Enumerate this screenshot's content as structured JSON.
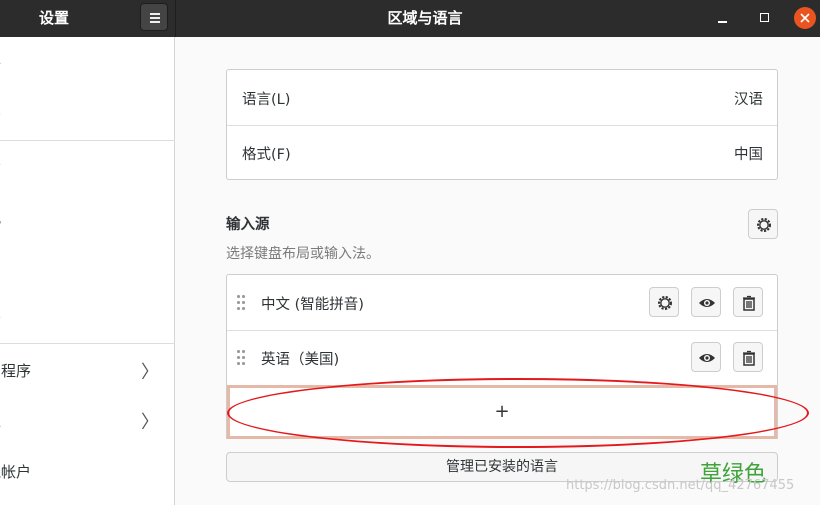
{
  "header": {
    "app_title": "设置",
    "page_title": "区域与语言"
  },
  "sidebar": {
    "items": [
      {
        "label": "络"
      },
      {
        "label": "牙"
      },
      {
        "label": "景"
      },
      {
        "label": "观"
      },
      {
        "label": "口"
      },
      {
        "label": "索"
      },
      {
        "label": "用程序"
      },
      {
        "label": "私"
      },
      {
        "label": "线帐户"
      }
    ]
  },
  "settings": {
    "language_label": "语言(L)",
    "language_value": "汉语",
    "formats_label": "格式(F)",
    "formats_value": "中国"
  },
  "input_sources": {
    "title": "输入源",
    "subtitle": "选择键盘布局或输入法。",
    "items": [
      {
        "label": "中文 (智能拼音)"
      },
      {
        "label": "英语（美国)"
      }
    ],
    "add_symbol": "+",
    "manage_button": "管理已安装的语言"
  },
  "overlay": {
    "stamp_text": "草绿色",
    "watermark": "https://blog.csdn.net/qq_42767455"
  },
  "colors": {
    "accent": "#e95420",
    "highlight_border": "#e5b8a7",
    "annotation": "#e4191c",
    "stamp": "#3fa33a"
  }
}
